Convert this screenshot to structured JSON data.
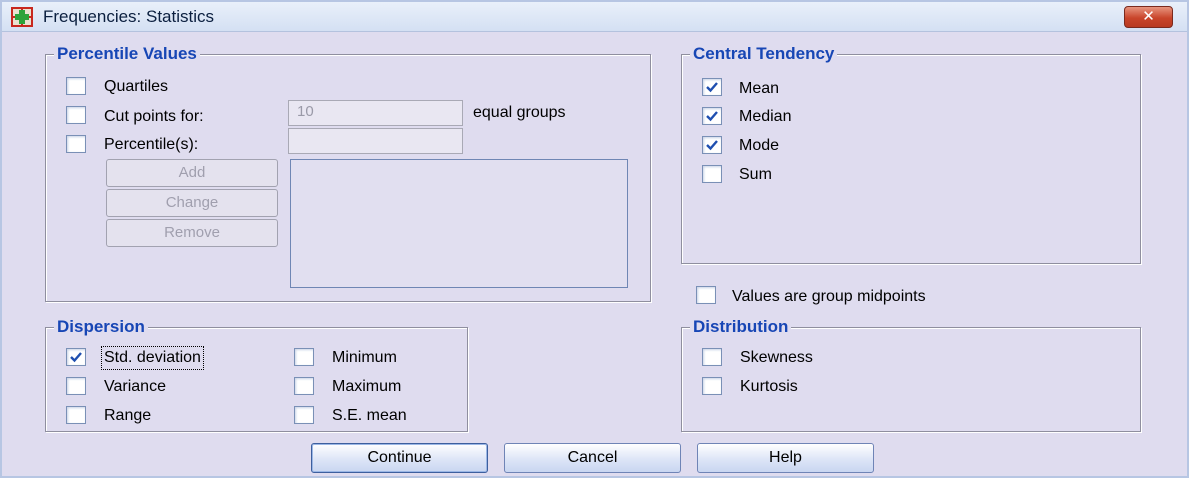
{
  "window": {
    "title": "Frequencies: Statistics",
    "close_glyph": "✕",
    "icon": "spss-frequencies-icon"
  },
  "percentile_values": {
    "title": "Percentile Values",
    "quartiles": {
      "label": "Quartiles",
      "checked": false
    },
    "cut_points": {
      "label": "Cut points for:",
      "checked": false,
      "value": "10",
      "suffix": "equal groups"
    },
    "percentiles": {
      "label": "Percentile(s):",
      "checked": false,
      "value": ""
    },
    "buttons": {
      "add": "Add",
      "change": "Change",
      "remove": "Remove"
    }
  },
  "central_tendency": {
    "title": "Central Tendency",
    "items": [
      {
        "label": "Mean",
        "checked": true
      },
      {
        "label": "Median",
        "checked": true
      },
      {
        "label": "Mode",
        "checked": true
      },
      {
        "label": "Sum",
        "checked": false
      }
    ]
  },
  "group_midpoints": {
    "label": "Values are group midpoints",
    "checked": false
  },
  "dispersion": {
    "title": "Dispersion",
    "items": [
      {
        "label": "Std. deviation",
        "checked": true
      },
      {
        "label": "Variance",
        "checked": false
      },
      {
        "label": "Range",
        "checked": false
      },
      {
        "label": "Minimum",
        "checked": false
      },
      {
        "label": "Maximum",
        "checked": false
      },
      {
        "label": "S.E. mean",
        "checked": false
      }
    ]
  },
  "distribution": {
    "title": "Distribution",
    "items": [
      {
        "label": "Skewness",
        "checked": false
      },
      {
        "label": "Kurtosis",
        "checked": false
      }
    ]
  },
  "footer": {
    "continue": "Continue",
    "cancel": "Cancel",
    "help": "Help"
  },
  "colors": {
    "dialog_bg": "#dfdcef",
    "group_title": "#1746b5",
    "check": "#1f4fb0",
    "close_button": "#c9452b"
  }
}
